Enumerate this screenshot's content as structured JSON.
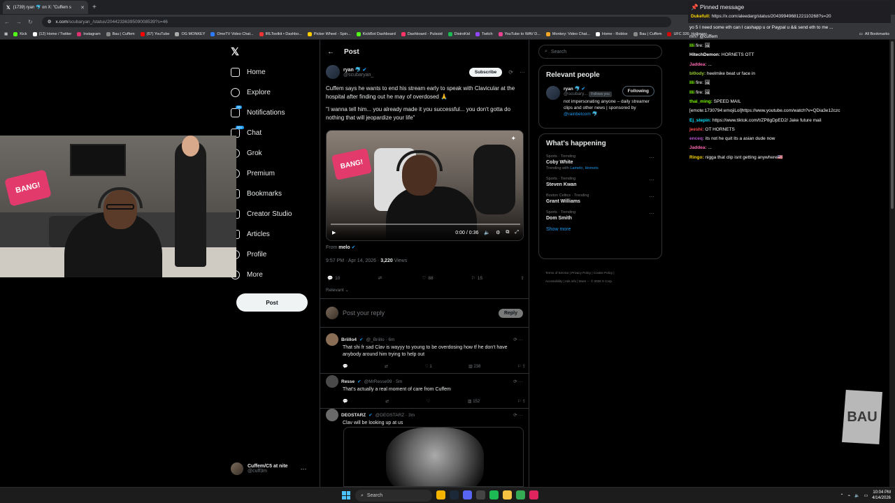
{
  "browser": {
    "tab_title": "(1739) ryan 🐬 on X: \"Cuffem s",
    "url_host": "x.com",
    "url_path": "/scubaryan_/status/2044233639509008539?s=46",
    "bookmarks": [
      "Kick",
      "(12) Home / Twitter",
      "Instagram",
      "Bau | Cuffem",
      "(57) YouTube",
      "OG MONKEY",
      "OmeTV Video Chat...",
      "IRLToolkit • Dashbo...",
      "Picker Wheel - Spin...",
      "KickBot Dashboard",
      "Dashboard - Pulsoid",
      "DistroKid",
      "Twitch",
      "YouTube to WAV D...",
      "Monkey: Video Chat...",
      "Home - Roblox",
      "Bau | Cuffem",
      "UFC 326: Holloway..."
    ],
    "all_bookmarks": "All Bookmarks"
  },
  "nav": {
    "items": [
      {
        "label": "Home",
        "icon": "home-icon"
      },
      {
        "label": "Explore",
        "icon": "search-icon"
      },
      {
        "label": "Notifications",
        "icon": "bell-icon",
        "badge": "20"
      },
      {
        "label": "Chat",
        "icon": "chat-icon",
        "badge": "20+"
      },
      {
        "label": "Grok",
        "icon": "grok-icon"
      },
      {
        "label": "Premium",
        "icon": "x-premium-icon"
      },
      {
        "label": "Bookmarks",
        "icon": "bookmark-icon"
      },
      {
        "label": "Creator Studio",
        "icon": "creator-studio-icon"
      },
      {
        "label": "Articles",
        "icon": "articles-icon"
      },
      {
        "label": "Profile",
        "icon": "profile-icon"
      },
      {
        "label": "More",
        "icon": "more-icon"
      }
    ],
    "post_button": "Post",
    "account_name": "Cuffem/C5 at nite",
    "account_handle": "@cuff3m"
  },
  "webcam": {
    "sign_text": "BANG!"
  },
  "post": {
    "header": "Post",
    "author_name": "ryan 🐬",
    "author_handle": "@scubaryan_",
    "subscribe": "Subscribe",
    "text_1": "Cuffem says he wants to end his stream early to speak with Clavicular at the hospital after finding out he may of overdosed 🙏",
    "text_2": "\"I wanna tell him... you already made it you successful... you don't gotta do nothing that will jeopardize your life\"",
    "video_time": "0:00 / 0:36",
    "video_sign": "BANG!",
    "from_label": "From",
    "from_name": "melo",
    "timestamp": "9:57 PM · Apr 14, 2026 · ",
    "views": "3,220",
    "views_label": " Views",
    "replies": "10",
    "retweets": "",
    "likes": "88",
    "bookmarks": "15",
    "relevant": "Relevant",
    "reply_placeholder": "Post your reply",
    "reply_button": "Reply"
  },
  "replies": [
    {
      "name": "Briillo4",
      "handle": "@_Briillo · 6m",
      "text": "That shi fr sad Clav is wayyy to young to be overdosing how tf he don't have anybody around him trying to help out",
      "likes": "1",
      "views": "238",
      "color": "#8a6d55"
    },
    {
      "name": "Resse",
      "handle": "@MrResse99 · 5m",
      "text": "That's actually a real moment of care from Cuffem",
      "likes": "",
      "views": "152",
      "color": "#4a4a4a"
    },
    {
      "name": "DEOSTARZ",
      "handle": "@DEOSTARZ · 3m",
      "text": "Clav will be looking up at us",
      "likes": "",
      "views": "",
      "color": "#6a6a6a"
    }
  ],
  "right": {
    "search_placeholder": "Search",
    "relevant_title": "Relevant people",
    "rp_name": "ryan 🐬",
    "rp_handle": "@scubary...",
    "rp_follows_you": "Follows you",
    "rp_follow_button": "Following",
    "rp_bio_1": "not impersonating anyone – daily streamer clips and other news | sponsored by ",
    "rp_bio_link": "@rainbetcom",
    "rp_bio_end": " 🐬",
    "happening_title": "What's happening",
    "trends": [
      {
        "category": "Sports · Trending",
        "title": "Coby White",
        "with_label": "Trending with ",
        "with": "Lamelo, Hornets"
      },
      {
        "category": "Sports · Trending",
        "title": "Steven Kwan",
        "with_label": "",
        "with": ""
      },
      {
        "category": "Boston Celtics · Trending",
        "title": "Grant Williams",
        "with_label": "",
        "with": ""
      },
      {
        "category": "Sports · Trending",
        "title": "Dom Smith",
        "with_label": "",
        "with": ""
      }
    ],
    "show_more": "Show more",
    "footer_1": "Terms of Service  |  Privacy Policy  |  Cookie Policy  |",
    "footer_2": "Accessibility  |  Ads info  |  More ···  © 2026 X Corp."
  },
  "chat": {
    "pinned_title": "📌 Pinned message",
    "pinned_user": "Dukefull:",
    "pinned_text": " https://x.com/aleedarg/status/2043994968122110268?s=20",
    "lines": [
      {
        "user": "",
        "text": "yo 5 I need some eth can I cashapp u or Paypal u && send eth to me ...",
        "color": "#ff4d4d"
      },
      {
        "user": "",
        "text": "mh? @cuffem",
        "color": "#fff"
      },
      {
        "user": "Illi",
        "text": " fire: 🖼",
        "color": "#7cfc00"
      },
      {
        "user": "HitechDemon:",
        "text": " HORNETS OTT",
        "color": "#ffffff"
      },
      {
        "user": "Jaddea:",
        "text": " ...",
        "color": "#ff69b4"
      },
      {
        "user": "bl0ody:",
        "text": " heelmike beat ur face in",
        "color": "#9acd32"
      },
      {
        "user": "Illi",
        "text": " fire: 🖼",
        "color": "#7cfc00"
      },
      {
        "user": "Illi",
        "text": " fire: 🖼",
        "color": "#7cfc00"
      },
      {
        "user": "thai_ming:",
        "text": " SPEED MAIL",
        "color": "#7cfc00"
      },
      {
        "user": "",
        "text": "[emote:1730794:emojiLol]https://www.youtube.com/watch?v=QDia3e12czc",
        "color": "#fff"
      },
      {
        "user": "Ej_stepin:",
        "text": " https://www.tiktok.com/t/ZP8gDpED2/ Jake future mail",
        "color": "#00e5ff"
      },
      {
        "user": "jeeshi:",
        "text": " OT HORNETS",
        "color": "#ff4d4d"
      },
      {
        "user": "enceq:",
        "text": " its not he quit its a asian dude now",
        "color": "#ba55d3"
      },
      {
        "user": "Jaddea:",
        "text": " ...",
        "color": "#ff69b4"
      },
      {
        "user": "Ringo:",
        "text": " nigga that clip isnt getting anywhere🇺🇸",
        "color": "#ffd700"
      }
    ]
  },
  "watermark": "BAU",
  "taskbar": {
    "search": "Search",
    "time": "10:04 PM",
    "date": "4/14/2026"
  },
  "colors": {
    "accent": "#1d9bf0",
    "background": "#000000",
    "border": "#2f3336",
    "muted": "#71767b"
  }
}
